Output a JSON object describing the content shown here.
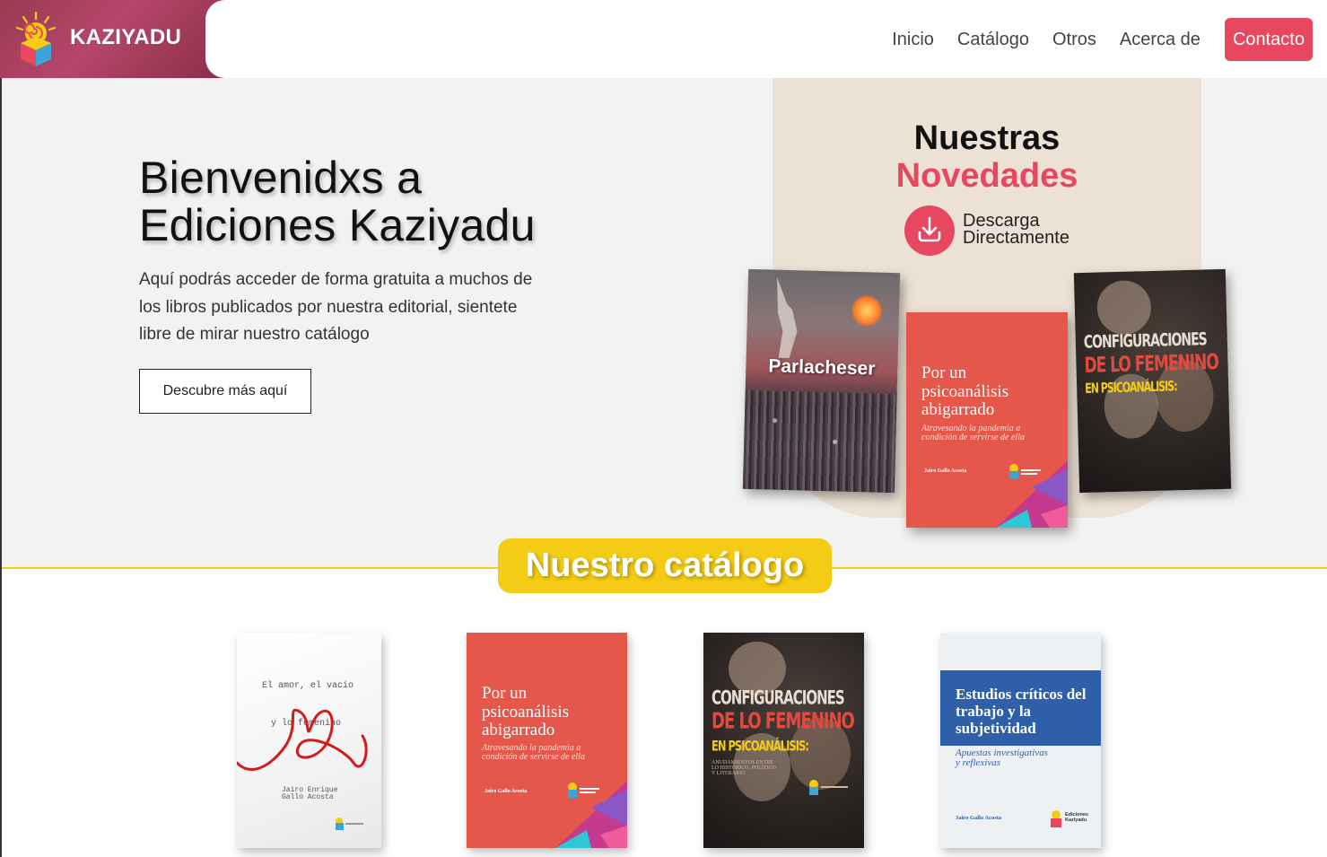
{
  "header": {
    "brand": "KAZIYADU",
    "nav": [
      "Inicio",
      "Catálogo",
      "Otros",
      "Acerca de"
    ],
    "cta": "Contacto"
  },
  "hero": {
    "title_line1": "Bienvenidxs a",
    "title_line2": "Ediciones Kaziyadu",
    "description": "Aquí podrás acceder de forma gratuita a muchos de los libros publicados por nuestra editorial, sientete libre de mirar nuestro catálogo",
    "button": "Descubre más aquí"
  },
  "novedades": {
    "title_line1": "Nuestras",
    "title_line2": "Novedades",
    "download_line1": "Descarga",
    "download_line2": "Directamente",
    "books": {
      "parlacheser": {
        "title": "Parlacheser"
      },
      "psico": {
        "title_line1": "Por un",
        "title_line2": "psicoanálisis",
        "title_line3": "abigarrado",
        "subtitle_line1": "Atravesando la pandemia a",
        "subtitle_line2": "condición de servirse de ella",
        "author": "Jairo Gallo Acosta"
      },
      "config": {
        "title_line1": "CONFIGURACIONES",
        "title_line2": "DE LO FEMENINO",
        "title_line3": "EN PSICOANÁLISIS:"
      }
    }
  },
  "catalog": {
    "title": "Nuestro catálogo",
    "books": {
      "amor": {
        "title_line1": "El amor, el vacío",
        "title_line2": "y lo femenino",
        "author_line1": "Jairo Enrique",
        "author_line2": "Gallo Acosta"
      },
      "psico": {
        "title_line1": "Por un",
        "title_line2": "psicoanálisis",
        "title_line3": "abigarrado",
        "subtitle_line1": "Atravesando la pandemia a",
        "subtitle_line2": "condición de servirse de ella",
        "author": "Jairo Gallo Acosta"
      },
      "config": {
        "title_line1": "CONFIGURACIONES",
        "title_line2": "DE LO FEMENINO",
        "title_line3": "EN PSICOANÁLISIS:",
        "subtitle_line1": "ANUDAMIENTOS ENTRE",
        "subtitle_line2": "LO HISTÓRICO, POLÍTICO",
        "subtitle_line3": "Y LITERARIO"
      },
      "estudios": {
        "title": "Estudios críticos del trabajo y la subjetividad",
        "subtitle_line1": "Apuestas  investigativas",
        "subtitle_line2": "y reflexivas",
        "author": "Jairo Gallo Acosta",
        "publisher_line1": "Ediciones",
        "publisher_line2": "Kaziyadu"
      }
    }
  },
  "colors": {
    "accent": "#e8485f",
    "yellow": "#f5cc15",
    "panel": "#ece1d5",
    "book_red": "#e5564b",
    "book_blue": "#2f5fa8"
  }
}
